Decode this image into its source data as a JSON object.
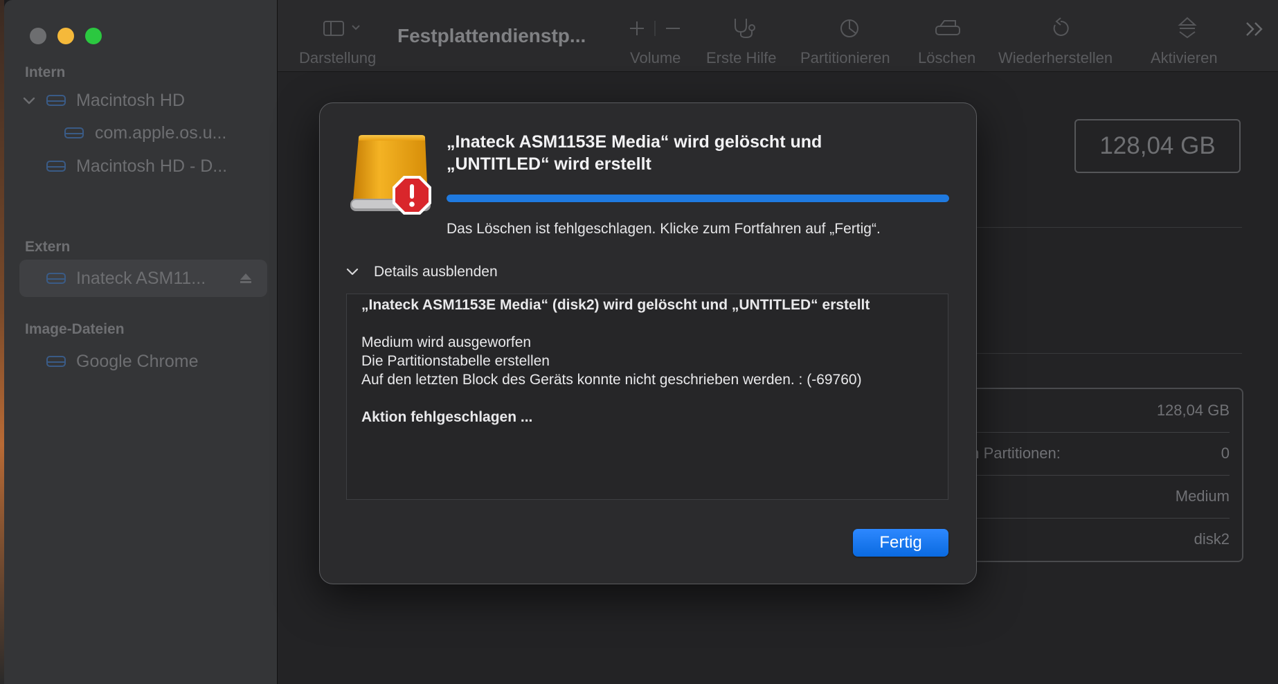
{
  "window": {
    "title": "Festplattendienstp..."
  },
  "sidebar": {
    "sections": [
      {
        "label": "Intern"
      },
      {
        "label": "Extern"
      },
      {
        "label": "Image-Dateien"
      }
    ],
    "items": [
      {
        "label": "Macintosh HD"
      },
      {
        "label": "com.apple.os.u..."
      },
      {
        "label": "Macintosh HD - D..."
      },
      {
        "label": "Inateck ASM11..."
      },
      {
        "label": "Google Chrome"
      }
    ]
  },
  "toolbar": {
    "display_label": "Darstellung",
    "volume_label": "Volume",
    "first_aid_label": "Erste Hilfe",
    "partition_label": "Partitionieren",
    "erase_label": "Löschen",
    "restore_label": "Wiederherstellen",
    "activate_label": "Aktivieren"
  },
  "main": {
    "capacity": "128,04 GB",
    "info_rows": [
      {
        "label": "",
        "value": "128,04 GB"
      },
      {
        "label": "en Partitionen:",
        "value": "0"
      },
      {
        "label": "",
        "value": "Medium"
      },
      {
        "label": "",
        "value": "disk2"
      }
    ]
  },
  "dialog": {
    "title_line1": "„Inateck ASM1153E Media“ wird gelöscht und",
    "title_line2": "„UNTITLED“ wird erstellt",
    "progress": 1.0,
    "status": "Das Löschen ist fehlgeschlagen. Klicke zum Fortfahren auf „Fertig“.",
    "details_toggle": "Details ausblenden",
    "details": {
      "heading": "„Inateck ASM1153E Media“ (disk2) wird gelöscht und „UNTITLED“ erstellt",
      "line1": "Medium wird ausgeworfen",
      "line2": "Die Partitionstabelle erstellen",
      "line3": "Auf den letzten Block des Geräts konnte nicht geschrieben werden. : (-69760)",
      "result": "Aktion fehlgeschlagen ..."
    },
    "done_button": "Fertig"
  },
  "colors": {
    "accent": "#1f7ae0",
    "warning": "#d9262b",
    "drive": "#e8a10a"
  },
  "icons": [
    "drive-icon",
    "warning-icon",
    "chevron-down-icon",
    "eject-icon",
    "sidebar-toggle-icon",
    "plus-icon",
    "minus-icon",
    "stethoscope-icon",
    "pie-chart-icon",
    "erase-drive-icon",
    "restore-icon",
    "activate-icon",
    "more-icon"
  ]
}
